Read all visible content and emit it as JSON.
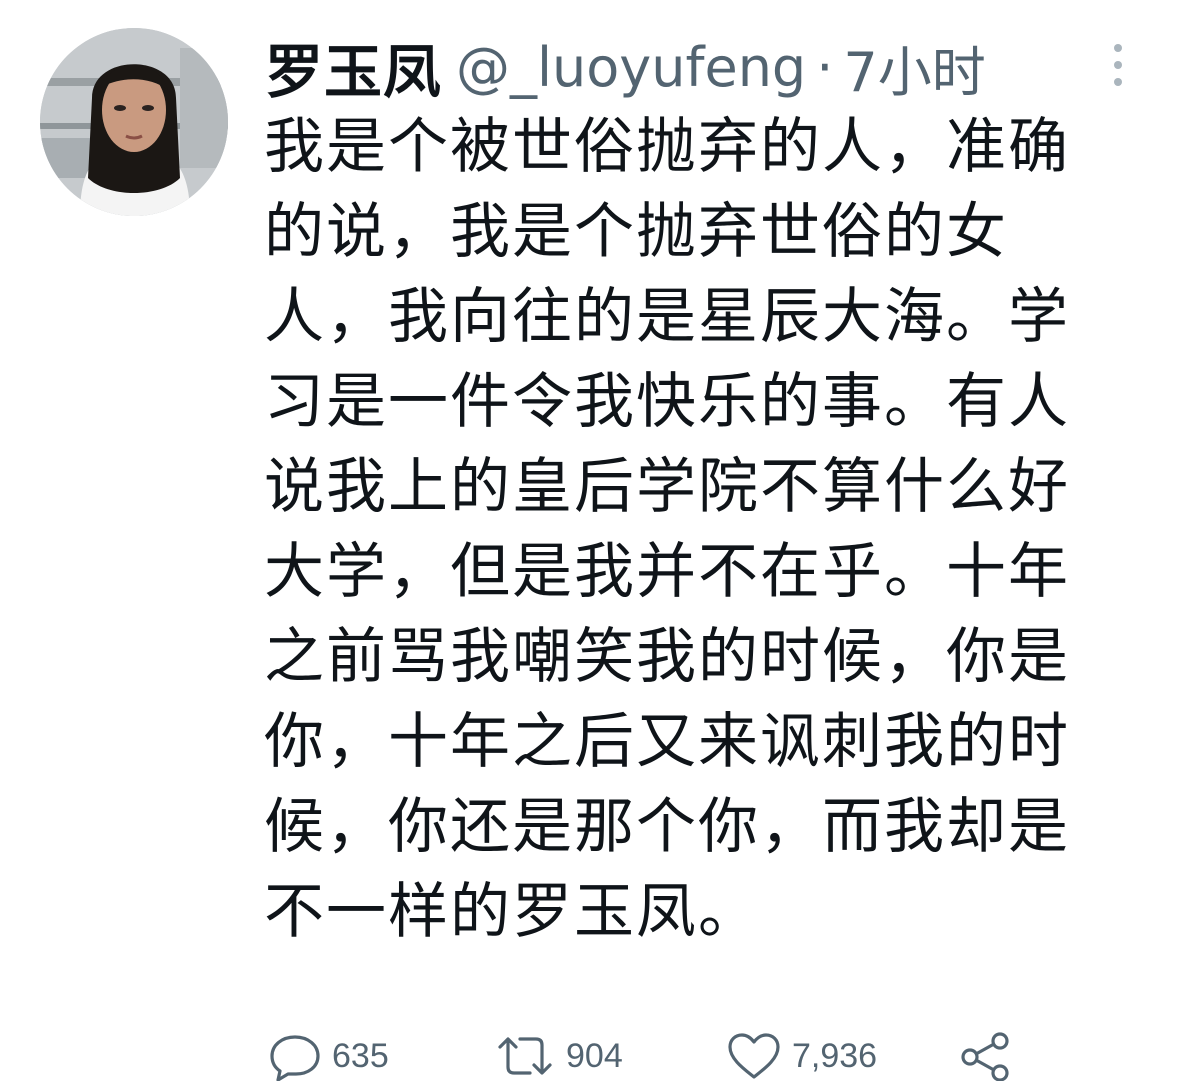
{
  "tweet": {
    "display_name": "罗玉凤",
    "handle": "@_luoyufeng",
    "separator": "·",
    "time": "7小时",
    "text_lines": [
      "我是个被世俗抛弃的人，准确",
      "的说，我是个抛弃世俗的女",
      "人，我向往的是星辰大海。学",
      "习是一件令我快乐的事。有人",
      "说我上的皇后学院不算什么好",
      "大学，但是我并不在乎。十年",
      "之前骂我嘲笑我的时候，你是",
      "你，十年之后又来讽刺我的时",
      "候，你还是那个你，而我却是",
      "不一样的罗玉凤。"
    ],
    "actions": {
      "reply_icon": "reply-icon",
      "reply_count": "635",
      "retweet_icon": "retweet-icon",
      "retweet_count": "904",
      "like_icon": "heart-icon",
      "like_count": "7,936",
      "share_icon": "share-icon"
    }
  },
  "colors": {
    "text_primary": "#0f1419",
    "text_secondary": "#536471",
    "background": "#ffffff"
  }
}
